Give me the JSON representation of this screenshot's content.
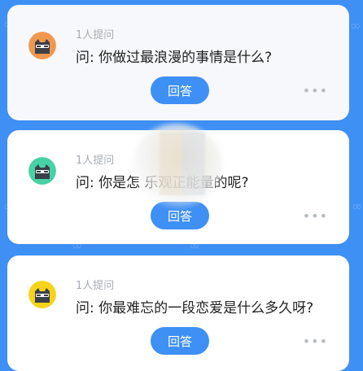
{
  "questions": [
    {
      "meta": "1人提问",
      "text": "问: 你做过最浪漫的事情是什么?",
      "button": "回答",
      "avatar_color": "#f0984f"
    },
    {
      "meta": "1人提问",
      "text": "问: 你是怎                  乐观正能量的呢?",
      "button": "回答",
      "avatar_color": "#47d1a5"
    },
    {
      "meta": "1人提问",
      "text": "问: 你最难忘的一段恋爱是什么多久呀?",
      "button": "回答",
      "avatar_color": "#f5d31a"
    }
  ],
  "more_label": "•••"
}
